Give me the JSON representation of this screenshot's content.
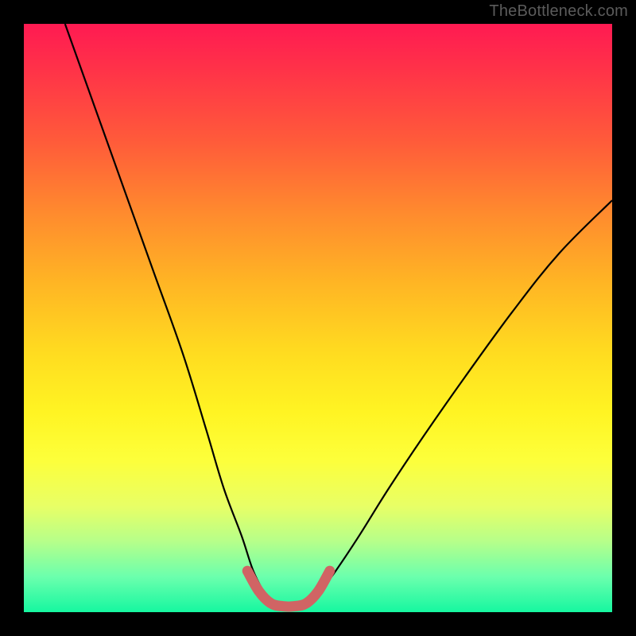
{
  "watermark": "TheBottleneck.com",
  "chart_data": {
    "type": "line",
    "title": "",
    "xlabel": "",
    "ylabel": "",
    "xlim": [
      0,
      1
    ],
    "ylim": [
      0,
      1
    ],
    "note": "Axes are unlabeled; values are approximate normalized coordinates read from the plot geometry (0 = bottom/left of colored area, 1 = top/right).",
    "series": [
      {
        "name": "left-branch",
        "x": [
          0.07,
          0.12,
          0.17,
          0.22,
          0.27,
          0.31,
          0.34,
          0.37,
          0.39,
          0.41
        ],
        "y": [
          1.0,
          0.86,
          0.72,
          0.58,
          0.44,
          0.31,
          0.21,
          0.13,
          0.07,
          0.03
        ]
      },
      {
        "name": "right-branch",
        "x": [
          0.5,
          0.53,
          0.57,
          0.62,
          0.68,
          0.75,
          0.83,
          0.91,
          1.0
        ],
        "y": [
          0.03,
          0.07,
          0.13,
          0.21,
          0.3,
          0.4,
          0.51,
          0.61,
          0.7
        ]
      },
      {
        "name": "trough-highlight",
        "x": [
          0.38,
          0.4,
          0.42,
          0.44,
          0.46,
          0.48,
          0.5,
          0.52
        ],
        "y": [
          0.07,
          0.035,
          0.015,
          0.01,
          0.01,
          0.015,
          0.035,
          0.07
        ]
      }
    ],
    "background_gradient": {
      "top_color": "#ff1a52",
      "bottom_color": "#16f7a0"
    }
  }
}
